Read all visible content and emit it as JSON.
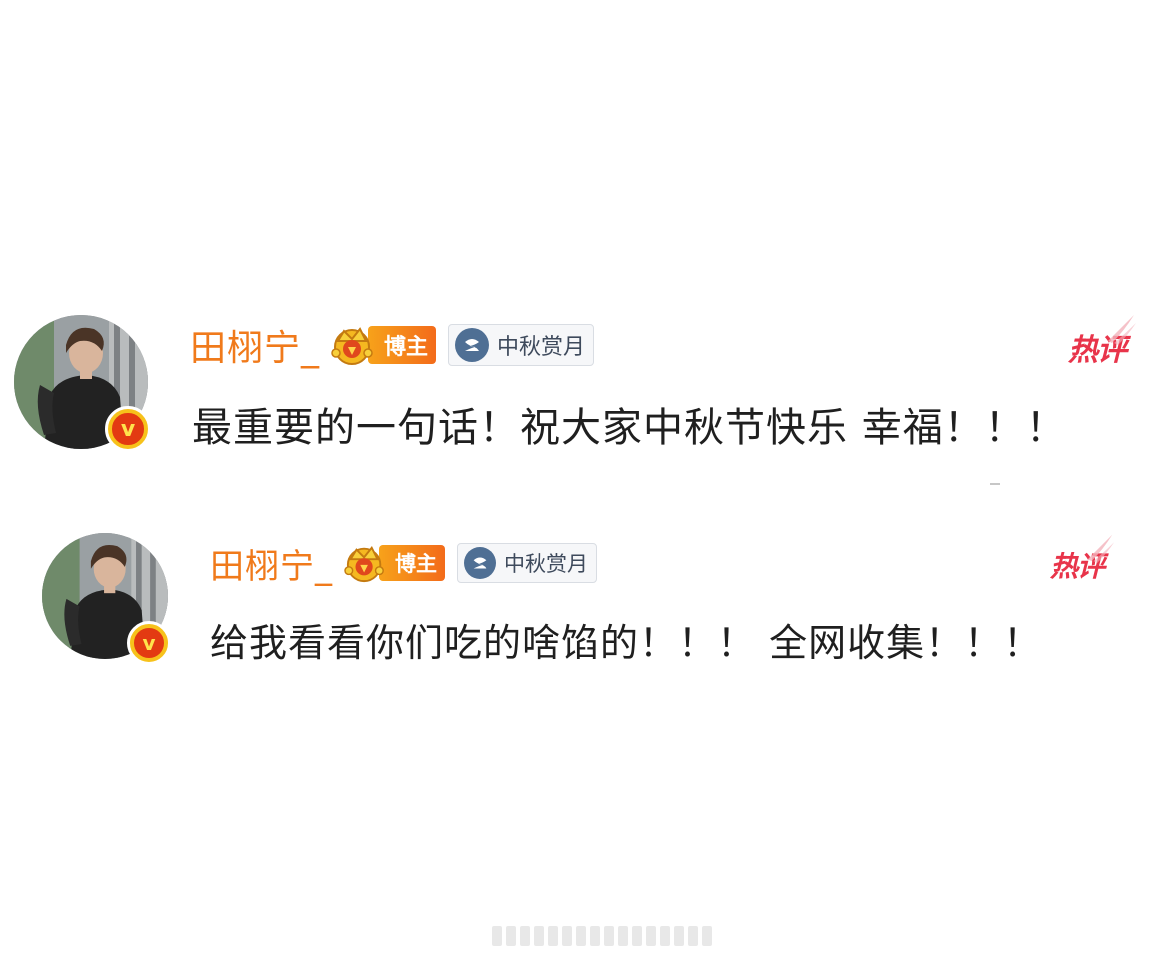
{
  "comments": [
    {
      "username": "田栩宁_",
      "blogger_badge": "博主",
      "topic_badge": "中秋赏月",
      "hot_tag": "热评",
      "content": "最重要的一句话！祝大家中秋节快乐 幸福！！！",
      "verified_mark": "v"
    },
    {
      "username": "田栩宁_",
      "blogger_badge": "博主",
      "topic_badge": "中秋赏月",
      "hot_tag": "热评",
      "content": "给我看看你们吃的啥馅的！！！ 全网收集！！！",
      "verified_mark": "v"
    }
  ],
  "colors": {
    "username": "#f07a1b",
    "hot_tag": "#e8344a",
    "badge_gradient_start": "#f7a21a",
    "badge_gradient_end": "#f36b1a",
    "topic_icon": "#4f6f94",
    "verified_outer": "#f7c21b",
    "verified_inner": "#e33a12"
  },
  "icons": {
    "avatar": "user-avatar-photo",
    "verified": "verified-v-badge-icon",
    "crown": "crown-icon",
    "topic": "topic-circle-icon",
    "flare": "flare-icon"
  }
}
